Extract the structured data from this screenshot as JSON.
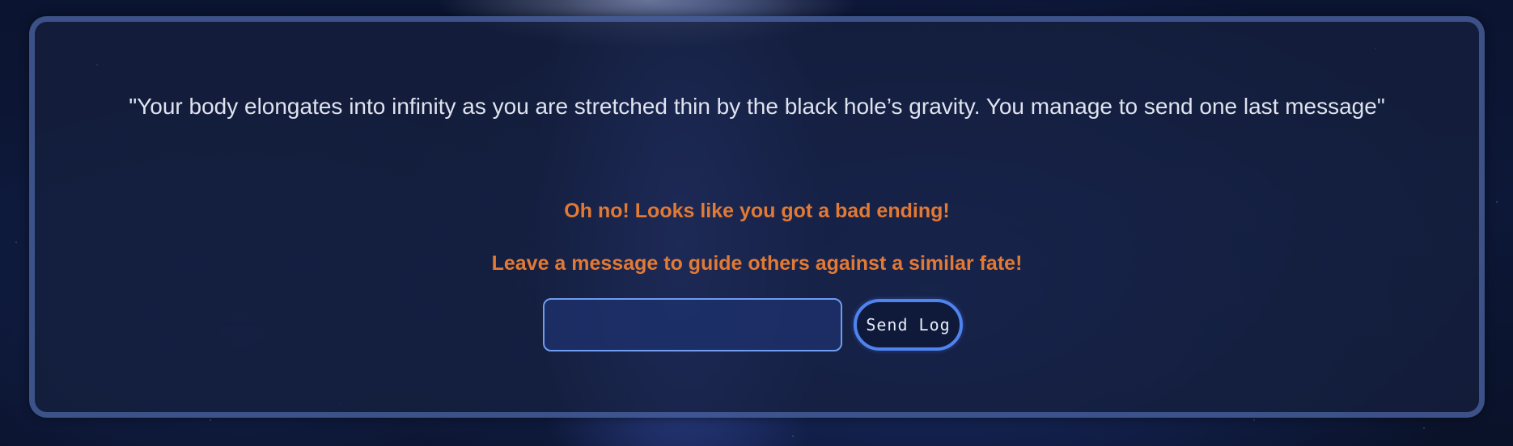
{
  "scene": {
    "story_text": "\"Your body elongates into infinity as you are stretched thin by the black hole’s gravity. You manage to send one last message\"",
    "bad_ending_text": "Oh no! Looks like you got a bad ending!",
    "guide_text": "Leave a message to guide others against a similar fate!"
  },
  "log_form": {
    "input_value": "",
    "input_placeholder": "",
    "send_label": "Send Log"
  },
  "colors": {
    "accent_orange": "#e27a35",
    "button_border_blue": "#4f83f0",
    "input_border_blue": "#6f9cf0",
    "panel_border": "#5f7dc8"
  }
}
